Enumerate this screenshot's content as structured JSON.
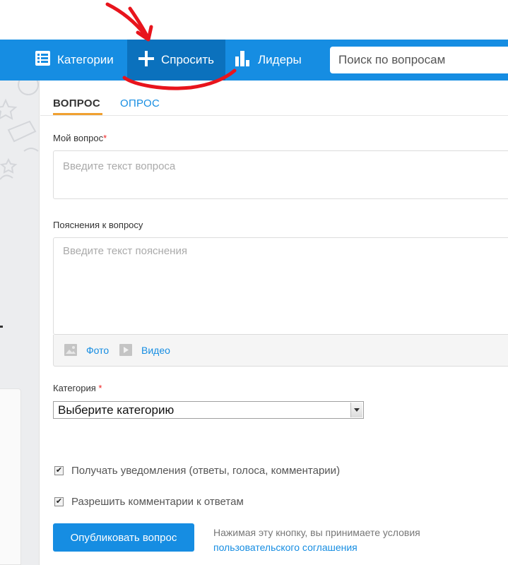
{
  "nav": {
    "categories_label": "Категории",
    "ask_label": "Спросить",
    "leaders_label": "Лидеры",
    "search_placeholder": "Поиск по вопросам"
  },
  "tabs": [
    {
      "label": "ВОПРОС",
      "active": true
    },
    {
      "label": "ОПРОС",
      "active": false
    }
  ],
  "form": {
    "question_label": "Мой вопрос",
    "required_mark": "*",
    "question_placeholder": "Введите текст вопроса",
    "details_label": "Пояснения к вопросу",
    "details_placeholder": "Введите текст пояснения",
    "photo_label": "Фото",
    "video_label": "Видео",
    "category_label": "Категория",
    "category_select_value": "Выберите категорию",
    "notify_checkbox_label": "Получать уведомления (ответы, голоса, комментарии)",
    "notify_checked": true,
    "comments_checkbox_label": "Разрешить комментарии к ответам",
    "comments_checked": true,
    "publish_label": "Опубликовать вопрос",
    "terms_text": "Нажимая эту кнопку, вы принимаете условия",
    "terms_link": "пользовательского соглашения"
  },
  "colors": {
    "brand_blue": "#168de2",
    "active_nav": "#0b71bd",
    "tab_underline": "#f0a030",
    "annotation_red": "#e8141c"
  },
  "icons": {
    "categories": "list-icon",
    "ask": "plus-icon",
    "leaders": "bar-chart-icon",
    "photo": "image-icon",
    "video": "play-icon"
  }
}
